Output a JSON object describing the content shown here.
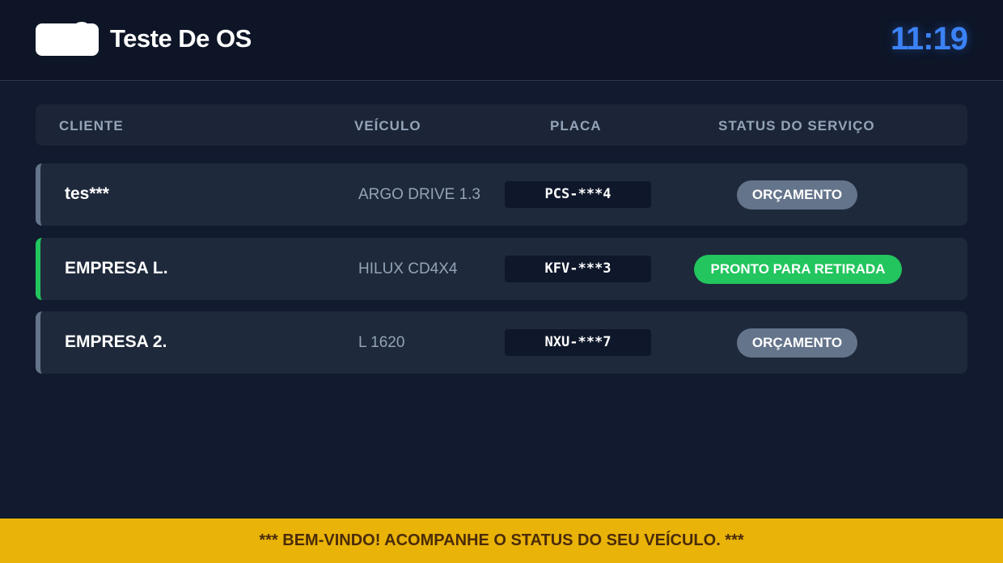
{
  "header": {
    "title": "Teste De OS",
    "clock": "11:19"
  },
  "table": {
    "columns": [
      "CLIENTE",
      "VEÍCULO",
      "PLACA",
      "STATUS DO SERVIÇO"
    ],
    "rows": [
      {
        "cliente": "tes***",
        "veiculo": "ARGO DRIVE 1.3",
        "placa": "PCS-***4",
        "status": "ORÇAMENTO",
        "status_color": "#64748b"
      },
      {
        "cliente": "EMPRESA L.",
        "veiculo": "HILUX CD4X4",
        "placa": "KFV-***3",
        "status": "PRONTO PARA RETIRADA",
        "status_color": "#22c55e"
      },
      {
        "cliente": "EMPRESA 2.",
        "veiculo": "L 1620",
        "placa": "NXU-***7",
        "status": "ORÇAMENTO",
        "status_color": "#64748b"
      }
    ]
  },
  "footer": {
    "ticker": "*** BEM-VINDO! ACOMPANHE O STATUS DO SEU VEÍCULO. ***"
  },
  "colors": {
    "background": "#111a2e",
    "accent_clock": "#3b82f6",
    "ticker_bg": "#eab308"
  }
}
